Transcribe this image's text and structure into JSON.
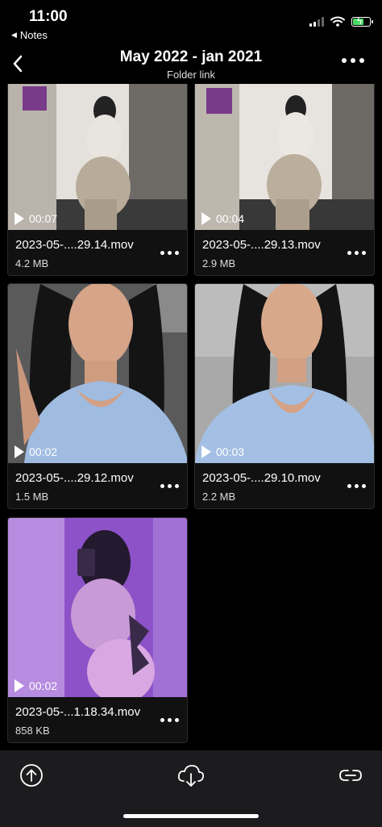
{
  "status_bar": {
    "time": "11:00",
    "back_app": "Notes",
    "icons": [
      "cellular-signal-icon",
      "wifi-icon",
      "battery-charging-icon"
    ]
  },
  "header": {
    "title": "May 2022 - jan 2021",
    "subtitle": "Folder link"
  },
  "items": [
    {
      "duration": "00:07",
      "name": "2023-05-....29.14.mov",
      "size": "4.2 MB"
    },
    {
      "duration": "00:04",
      "name": "2023-05-....29.13.mov",
      "size": "2.9 MB"
    },
    {
      "duration": "00:02",
      "name": "2023-05-....29.12.mov",
      "size": "1.5 MB"
    },
    {
      "duration": "00:03",
      "name": "2023-05-....29.10.mov",
      "size": "2.2 MB"
    },
    {
      "duration": "00:02",
      "name": "2023-05-...1.18.34.mov",
      "size": "858 KB"
    }
  ],
  "toolbar": {
    "icons": [
      "upload-icon",
      "cloud-download-icon",
      "link-icon"
    ]
  },
  "colors": {
    "background": "#000000",
    "card": "#111111",
    "toolbar": "#1c1c1e",
    "battery": "#4cd964"
  }
}
